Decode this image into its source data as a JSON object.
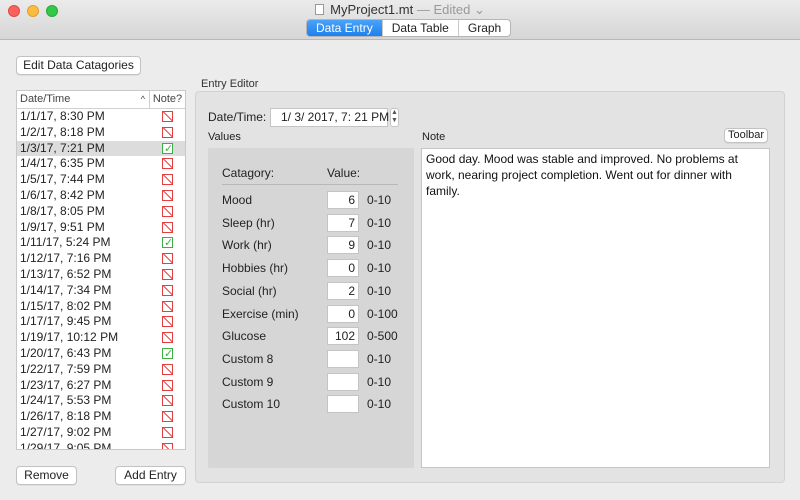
{
  "window": {
    "title": "MyProject1.mt",
    "status": "— Edited",
    "tabs": [
      {
        "label": "Data Entry",
        "active": true
      },
      {
        "label": "Data Table",
        "active": false
      },
      {
        "label": "Graph",
        "active": false
      }
    ],
    "accent_color": "#1e7ff0"
  },
  "toolbar": {
    "edit_categories_label": "Edit Data Catagories",
    "remove_label": "Remove",
    "add_entry_label": "Add Entry"
  },
  "list": {
    "col_date": "Date/Time",
    "col_note": "Note?",
    "rows": [
      {
        "date": "1/1/17, 8:30 PM",
        "note": false,
        "selected": false
      },
      {
        "date": "1/2/17, 8:18 PM",
        "note": false,
        "selected": false
      },
      {
        "date": "1/3/17, 7:21 PM",
        "note": true,
        "selected": true
      },
      {
        "date": "1/4/17, 6:35 PM",
        "note": false,
        "selected": false
      },
      {
        "date": "1/5/17, 7:44 PM",
        "note": false,
        "selected": false
      },
      {
        "date": "1/6/17, 8:42 PM",
        "note": false,
        "selected": false
      },
      {
        "date": "1/8/17, 8:05 PM",
        "note": false,
        "selected": false
      },
      {
        "date": "1/9/17, 9:51 PM",
        "note": false,
        "selected": false
      },
      {
        "date": "1/11/17, 5:24 PM",
        "note": true,
        "selected": false
      },
      {
        "date": "1/12/17, 7:16 PM",
        "note": false,
        "selected": false
      },
      {
        "date": "1/13/17, 6:52 PM",
        "note": false,
        "selected": false
      },
      {
        "date": "1/14/17, 7:34 PM",
        "note": false,
        "selected": false
      },
      {
        "date": "1/15/17, 8:02 PM",
        "note": false,
        "selected": false
      },
      {
        "date": "1/17/17, 9:45 PM",
        "note": false,
        "selected": false
      },
      {
        "date": "1/19/17, 10:12 PM",
        "note": false,
        "selected": false
      },
      {
        "date": "1/20/17, 6:43 PM",
        "note": true,
        "selected": false
      },
      {
        "date": "1/22/17, 7:59 PM",
        "note": false,
        "selected": false
      },
      {
        "date": "1/23/17, 6:27 PM",
        "note": false,
        "selected": false
      },
      {
        "date": "1/24/17, 5:53 PM",
        "note": false,
        "selected": false
      },
      {
        "date": "1/26/17, 8:18 PM",
        "note": false,
        "selected": false
      },
      {
        "date": "1/27/17, 9:02 PM",
        "note": false,
        "selected": false
      },
      {
        "date": "1/29/17, 9:05 PM",
        "note": false,
        "selected": false
      }
    ]
  },
  "editor": {
    "label": "Entry Editor",
    "datetime_label": "Date/Time:",
    "datetime_value": "1/  3/ 2017,   7: 21 PM",
    "values_label": "Values",
    "note_label": "Note",
    "toolbar_button": "Toolbar",
    "header_category": "Catagory:",
    "header_value": "Value:",
    "values": [
      {
        "category": "Mood",
        "value": "6",
        "range": "0-10"
      },
      {
        "category": "Sleep (hr)",
        "value": "7",
        "range": "0-10"
      },
      {
        "category": "Work (hr)",
        "value": "9",
        "range": "0-10"
      },
      {
        "category": "Hobbies (hr)",
        "value": "0",
        "range": "0-10"
      },
      {
        "category": "Social (hr)",
        "value": "2",
        "range": "0-10"
      },
      {
        "category": "Exercise (min)",
        "value": "0",
        "range": "0-100"
      },
      {
        "category": "Glucose",
        "value": "102",
        "range": "0-500"
      },
      {
        "category": "Custom 8",
        "value": "",
        "range": "0-10"
      },
      {
        "category": "Custom 9",
        "value": "",
        "range": "0-10"
      },
      {
        "category": "Custom 10",
        "value": "",
        "range": "0-10"
      }
    ],
    "note_text": "Good day. Mood was stable and improved. No problems at work, nearing project completion. Went out for dinner with family."
  }
}
